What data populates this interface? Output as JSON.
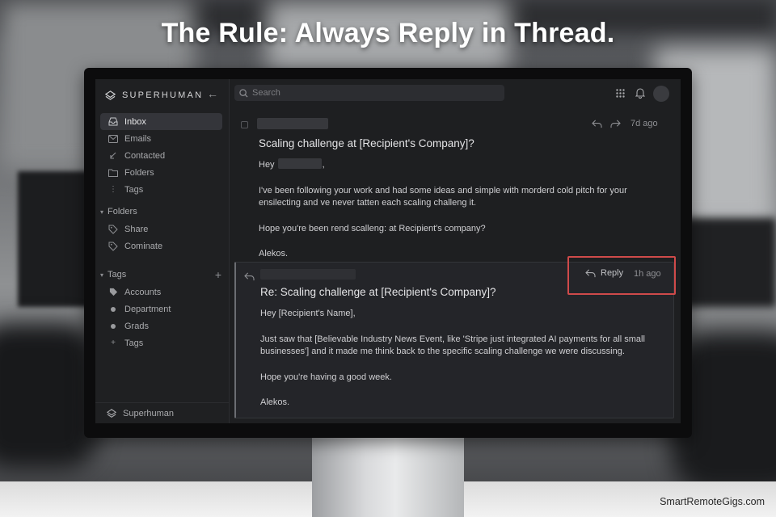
{
  "headline": "The Rule: Always Reply in Thread.",
  "watermark": "SmartRemoteGigs.com",
  "app": {
    "brand": "SUPERHUMAN",
    "search_placeholder": "Search",
    "footer_label": "Superhuman"
  },
  "sidebar": {
    "main": [
      {
        "label": "Inbox",
        "icon": "inbox-icon"
      },
      {
        "label": "Emails",
        "icon": "mail-icon"
      },
      {
        "label": "Contacted",
        "icon": "send-icon"
      },
      {
        "label": "Folders",
        "icon": "folder-icon"
      },
      {
        "label": "Tags",
        "icon": "more-icon"
      }
    ],
    "folders_heading": "Folders",
    "folders": [
      {
        "label": "Share",
        "icon": "tag-icon"
      },
      {
        "label": "Cominate",
        "icon": "tag-icon"
      }
    ],
    "tags_heading": "Tags",
    "tags": [
      {
        "label": "Accounts",
        "icon": "tag-fill-icon"
      },
      {
        "label": "Department",
        "icon": "dot-icon"
      },
      {
        "label": "Grads",
        "icon": "dot-icon"
      },
      {
        "label": "Tags",
        "icon": "plus-icon"
      }
    ]
  },
  "messages": {
    "first": {
      "time": "7d ago",
      "subject": "Scaling challenge at [Recipient's Company]?",
      "greeting": "Hey",
      "greeting_end": ",",
      "para1": "I've been following your work and had some ideas and simple with morderd cold pitch for your ensilecting and ve never tatten each scaling challeng it.",
      "para2": "Hope you're been rend scalleng: at Recipient's company?",
      "signoff": "Alekos."
    },
    "reply": {
      "button_label": "Reply",
      "time": "1h ago",
      "subject": "Re: Scaling challenge at [Recipient's Company]?",
      "greeting": "Hey [Recipient's Name],",
      "para1": "Just saw that [Believable Industry News Event, like 'Stripe just integrated AI payments for all small businesses'] and it made me think back to the specific scaling challenge we were discussing.",
      "para2": "Hope you're having a good week.",
      "signoff": "Alekos."
    }
  }
}
